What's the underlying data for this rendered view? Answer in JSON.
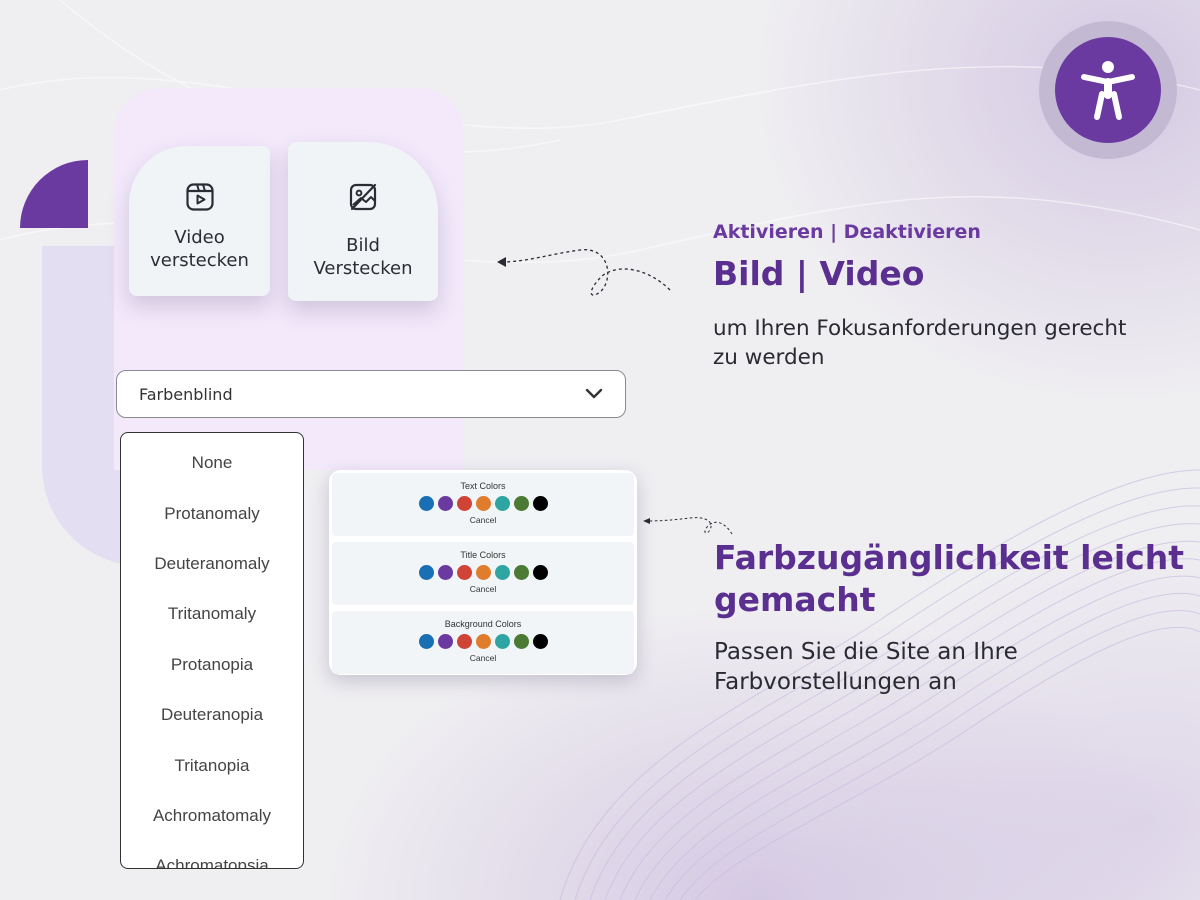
{
  "buttons": {
    "hide_video": "Video verstecken",
    "hide_image": "Bild Verstecken"
  },
  "dropdown": {
    "selected": "Farbenblind",
    "options": [
      "None",
      "Protanomaly",
      "Deuteranomaly",
      "Tritanomaly",
      "Protanopia",
      "Deuteranopia",
      "Tritanopia",
      "Achromatomaly",
      "Achromatopsia"
    ]
  },
  "color_picker": {
    "sections": [
      {
        "title": "Text Colors",
        "cancel": "Cancel"
      },
      {
        "title": "Title Colors",
        "cancel": "Cancel"
      },
      {
        "title": "Background Colors",
        "cancel": "Cancel"
      }
    ],
    "swatches": [
      "#1a6fb4",
      "#6b3aa0",
      "#cf4436",
      "#e07d2c",
      "#2fa5a3",
      "#4a7a33",
      "#000000"
    ]
  },
  "feature1": {
    "subtitle": "Aktivieren | Deaktivieren",
    "title": "Bild | Video",
    "description": "um Ihren Fokusanforderungen gerecht zu werden"
  },
  "feature2": {
    "title": "Farbzugänglichkeit leicht gemacht",
    "description": "Passen Sie die Site an Ihre Farbvorstellungen an"
  },
  "colors": {
    "accent": "#6b3aa0",
    "heading": "#5a2f8f"
  }
}
